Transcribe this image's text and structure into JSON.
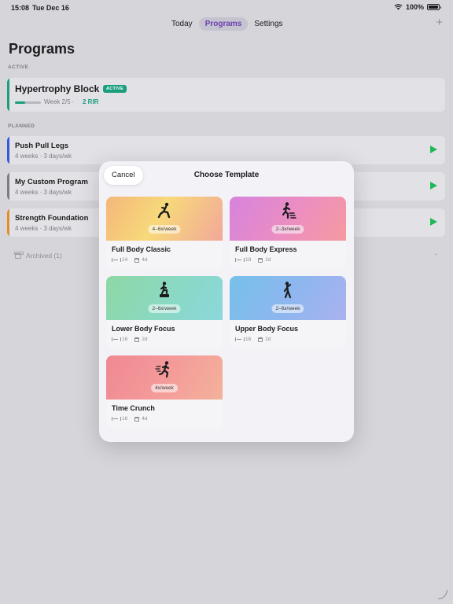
{
  "status": {
    "time": "15:08",
    "date": "Tue Dec 16",
    "battery": "100%"
  },
  "nav": {
    "tabs": [
      "Today",
      "Programs",
      "Settings"
    ],
    "active_tab": "Programs"
  },
  "page": {
    "title": "Programs"
  },
  "sections": {
    "active": "ACTIVE",
    "planned": "PLANNED"
  },
  "active_program": {
    "title": "Hypertrophy Block",
    "badge": "ACTIVE",
    "week": "Week 2/5",
    "separator": "·",
    "rir": "2 RIR",
    "progress_fraction": 0.4,
    "accent": "#1a9e7d"
  },
  "planned": [
    {
      "title": "Push Pull Legs",
      "sub": "4 weeks · 3 days/wk",
      "color": "#2f5bd8"
    },
    {
      "title": "My Custom Program",
      "sub": "4 weeks · 3 days/wk",
      "color": "#7c7c82"
    },
    {
      "title": "Strength Foundation",
      "sub": "4 weeks · 3 days/wk",
      "color": "#e68a2e"
    }
  ],
  "archived": {
    "label": "Archived (1)"
  },
  "modal": {
    "cancel": "Cancel",
    "title": "Choose Template",
    "templates": [
      {
        "name": "Full Body Classic",
        "freq": "4–6x/week",
        "exercises": "24",
        "days": "4d",
        "gradient": "g-orange",
        "icon": "lunge-figure-icon"
      },
      {
        "name": "Full Body Express",
        "freq": "2–3x/week",
        "exercises": "18",
        "days": "2d",
        "gradient": "g-pink",
        "icon": "stair-figure-icon"
      },
      {
        "name": "Lower Body Focus",
        "freq": "2–6x/week",
        "exercises": "16",
        "days": "2d",
        "gradient": "g-green",
        "icon": "step-figure-icon"
      },
      {
        "name": "Upper Body Focus",
        "freq": "2–6x/week",
        "exercises": "16",
        "days": "2d",
        "gradient": "g-blue",
        "icon": "stretch-figure-icon"
      },
      {
        "name": "Time Crunch",
        "freq": "4x/week",
        "exercises": "16",
        "days": "4d",
        "gradient": "g-red",
        "icon": "running-figure-icon"
      }
    ]
  }
}
